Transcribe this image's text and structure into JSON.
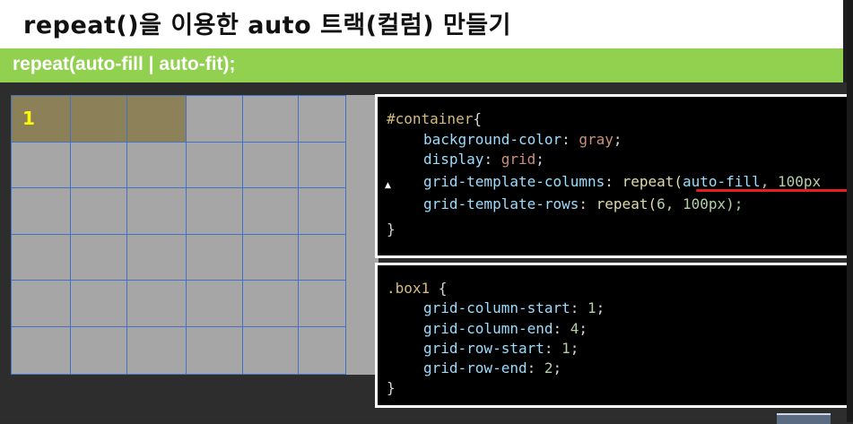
{
  "slide": {
    "title": "repeat()을 이용한 auto 트랙(컬럼) 만들기",
    "subtitle": "repeat(auto-fill | auto-fit);"
  },
  "grid_demo": {
    "box1_label": "1",
    "colors": {
      "cell_bg": "#a6a6a6",
      "grid_lines": "#4472c4",
      "box1_bg": "#8b7e55",
      "box1_text": "#ffff00"
    }
  },
  "code1": {
    "line1_selector": "#container",
    "line1_brace": "{",
    "line2_prop": "background-color",
    "line2_val": "gray",
    "line3_prop": "display",
    "line3_val": "grid",
    "line4_prop": "grid-template-columns",
    "line4_fn": "repeat(",
    "line4_val": "auto-fill",
    "line4_rest": ", 100px",
    "line5_prop": "grid-template-rows",
    "line5_fn": "repeat(",
    "line5_num": "6",
    "line5_rest": ", 100px);",
    "line6_brace": "}"
  },
  "code2": {
    "line1_selector": ".box1",
    "line1_brace": " {",
    "line2_prop": "grid-column-start",
    "line2_val": "1",
    "line3_prop": "grid-column-end",
    "line3_val": "4",
    "line4_prop": "grid-row-start",
    "line4_val": "1",
    "line5_prop": "grid-row-end",
    "line5_val": "2",
    "line6_brace": "}"
  },
  "icons": [
    "mouse-cursor-icon"
  ]
}
